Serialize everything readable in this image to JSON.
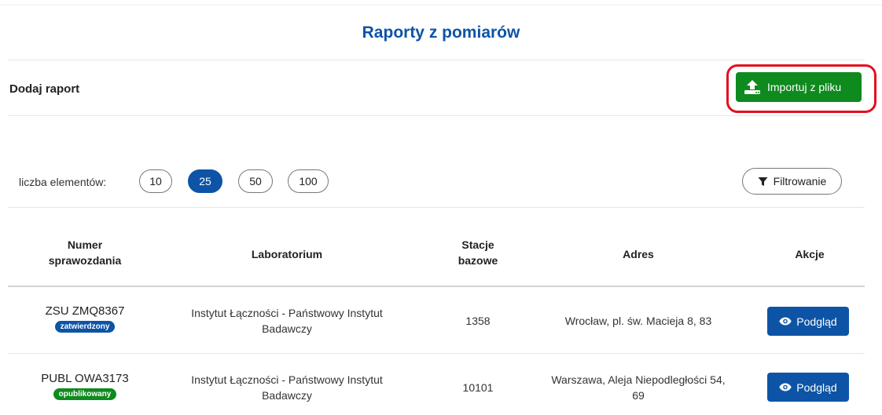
{
  "page": {
    "title": "Raporty z pomiarów"
  },
  "toolbar": {
    "add_label": "Dodaj raport",
    "import_label": "Importuj z pliku"
  },
  "pagination": {
    "label": "liczba elementów:",
    "options": [
      "10",
      "25",
      "50",
      "100"
    ],
    "selected": "25"
  },
  "filter": {
    "label": "Filtrowanie"
  },
  "table": {
    "headers": {
      "number_line1": "Numer",
      "number_line2": "sprawozdania",
      "lab": "Laboratorium",
      "stations_line1": "Stacje",
      "stations_line2": "bazowe",
      "address": "Adres",
      "actions": "Akcje"
    },
    "rows": [
      {
        "number": "ZSU ZMQ8367",
        "status": "zatwierdzony",
        "status_color": "#0d54a6",
        "lab_line1": "Instytut Łączności - Państwowy Instytut",
        "lab_line2": "Badawczy",
        "stations": "1358",
        "address_line1": "Wrocław, pl. św. Macieja 8, 83",
        "address_line2": "",
        "action": "Podgląd"
      },
      {
        "number": "PUBL OWA3173",
        "status": "opublikowany",
        "status_color": "#0f8a1e",
        "lab_line1": "Instytut Łączności - Państwowy Instytut",
        "lab_line2": "Badawczy",
        "stations": "10101",
        "address_line1": "Warszawa, Aleja Niepodległości 54,",
        "address_line2": "69",
        "action": "Podgląd"
      }
    ]
  },
  "colors": {
    "primary": "#0d54a6",
    "success": "#0f8a1e",
    "highlight": "#e3101d"
  },
  "icons": {
    "import": "upload-icon",
    "filter": "funnel-icon",
    "view": "eye-icon"
  }
}
